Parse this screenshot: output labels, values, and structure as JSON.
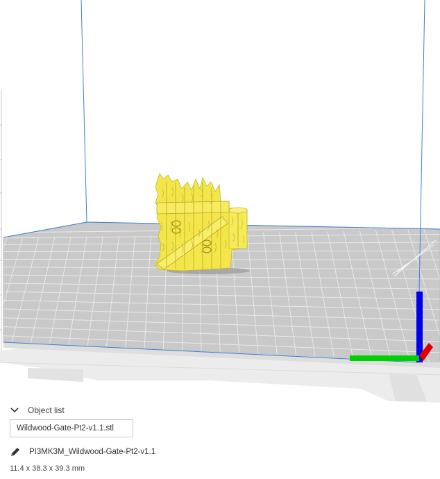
{
  "object_list": {
    "header_label": "Object list",
    "items": [
      {
        "name": "Wildwood-Gate-Pt2-v1.1.stl"
      }
    ]
  },
  "job": {
    "name": "PI3MK3M_Wildwood-Gate-Pt2-v1.1",
    "dimensions": "11.4 x 38.3 x 39.3 mm"
  },
  "colors": {
    "model": "#f3e64a",
    "build_plate": "#c6c6c6",
    "volume_edge": "#3f7fd6",
    "axis_x": "#e00000",
    "axis_y": "#00d000",
    "axis_z": "#0000ee"
  },
  "icons": [
    "chevron-down-icon",
    "pencil-icon"
  ]
}
